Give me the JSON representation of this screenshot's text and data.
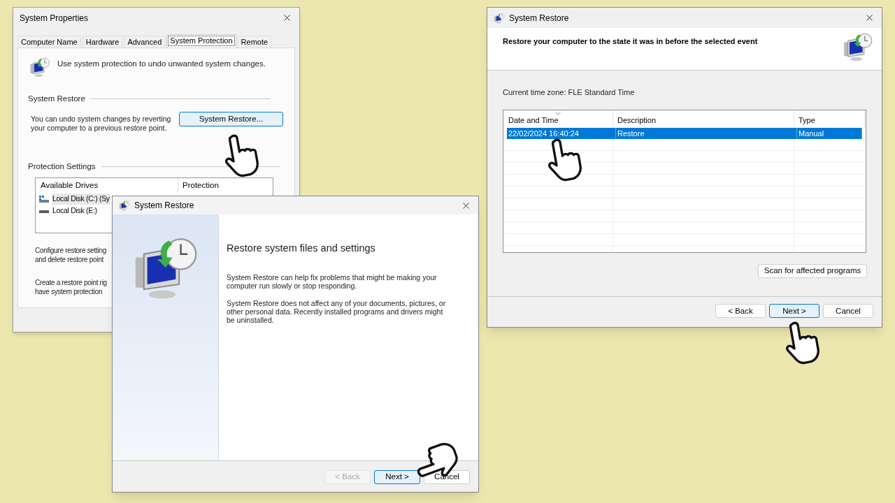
{
  "system_properties": {
    "title": "System Properties",
    "tabs": [
      {
        "label": "Computer Name",
        "selected": false
      },
      {
        "label": "Hardware",
        "selected": false
      },
      {
        "label": "Advanced",
        "selected": false
      },
      {
        "label": "System Protection",
        "selected": true
      },
      {
        "label": "Remote",
        "selected": false
      }
    ],
    "intro": "Use system protection to undo unwanted system changes.",
    "restore_heading": "System Restore",
    "restore_text": "You can undo system changes by reverting your computer to a previous restore point.",
    "restore_button": "System Restore...",
    "protection_heading": "Protection Settings",
    "columns": [
      "Available Drives",
      "Protection"
    ],
    "drives": [
      {
        "label": "Local Disk (C:) (Sy",
        "kind": "system",
        "selected": true
      },
      {
        "label": "Local Disk (E:)",
        "kind": "data",
        "selected": false
      }
    ],
    "configure_lines": [
      "Configure restore setting",
      "and delete restore point"
    ],
    "create_lines": [
      "Create a restore point rig",
      "have system protection"
    ]
  },
  "wizard": {
    "title": "System Restore",
    "heading": "Restore system files and settings",
    "paragraphs": [
      "System Restore can help fix problems that might be making your computer run slowly or stop responding.",
      "System Restore does not affect any of your documents, pictures, or other personal data. Recently installed programs and drivers might be uninstalled."
    ],
    "buttons": [
      {
        "label": "< Back",
        "disabled": true,
        "default": false
      },
      {
        "label": "Next >",
        "disabled": false,
        "default": true
      },
      {
        "label": "Cancel",
        "disabled": false,
        "default": false
      }
    ]
  },
  "restore_points": {
    "title": "System Restore",
    "heading": "Restore your computer to the state it was in before the selected event",
    "timezone": "Current time zone: FLE Standard Time",
    "columns": [
      {
        "label": "Date and Time",
        "sorted": true
      },
      {
        "label": "Description",
        "sorted": false
      },
      {
        "label": "Type",
        "sorted": false
      }
    ],
    "rows": [
      {
        "cells": [
          "22/02/2024 16:40:24",
          "Restore",
          "Manual"
        ],
        "selected": true
      }
    ],
    "scan_button": "Scan for affected programs",
    "buttons": [
      {
        "label": "< Back",
        "disabled": false,
        "default": false
      },
      {
        "label": "Next >",
        "disabled": false,
        "default": true
      },
      {
        "label": "Cancel",
        "disabled": false,
        "default": false
      }
    ]
  }
}
